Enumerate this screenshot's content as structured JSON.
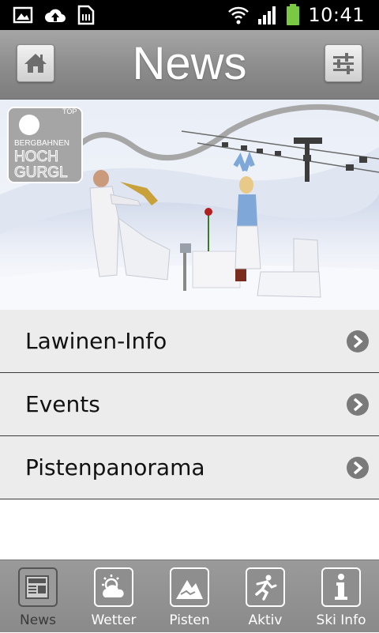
{
  "status_bar": {
    "time": "10:41",
    "left_icons": [
      "image-icon",
      "cloud-upload-icon",
      "sd-card-icon"
    ],
    "right_icons": [
      "wifi-icon",
      "signal-icon",
      "battery-icon"
    ],
    "battery_color": "#7ac943"
  },
  "header": {
    "title": "News",
    "left_button": "home-icon",
    "right_button": "settings-sliders-icon"
  },
  "banner": {
    "logo_lines": [
      "TOP",
      "BERGBAHNEN",
      "HOCH",
      "GURGL"
    ]
  },
  "menu": {
    "items": [
      {
        "label": "Lawinen-Info"
      },
      {
        "label": "Events"
      },
      {
        "label": "Pistenpanorama"
      }
    ]
  },
  "tabbar": {
    "active": "News",
    "tabs": [
      {
        "label": "News",
        "icon": "newspaper-icon"
      },
      {
        "label": "Wetter",
        "icon": "weather-icon"
      },
      {
        "label": "Pisten",
        "icon": "mountain-icon"
      },
      {
        "label": "Aktiv",
        "icon": "running-man-icon"
      },
      {
        "label": "Ski Info",
        "icon": "info-icon"
      }
    ]
  },
  "colors": {
    "header_bg": "#8c8c8c",
    "list_bg": "#ececec",
    "tabbar_bg": "#8f8f8f"
  }
}
